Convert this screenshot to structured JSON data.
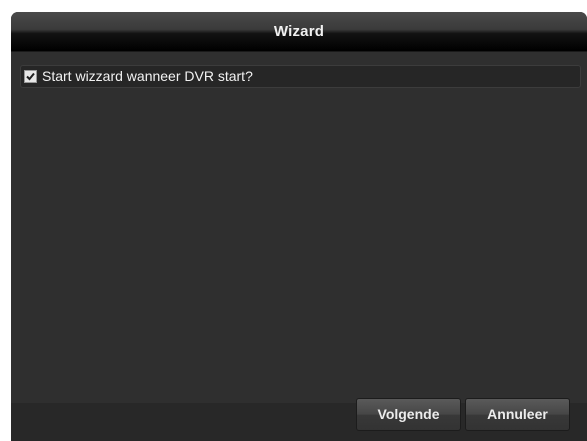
{
  "dialog": {
    "title": "Wizard",
    "option": {
      "label": "Start wizzard wanneer DVR start?",
      "checked": true
    },
    "buttons": {
      "next_label": "Volgende",
      "cancel_label": "Annuleer"
    }
  },
  "colors": {
    "background": "#2f2f2f",
    "title_text": "#f0f0f0",
    "text": "#f2f2f2",
    "checkbox_fill": "#e8e8e8",
    "checkmark": "#202020"
  },
  "icons": {
    "checkbox": "checkbox-checked-icon"
  }
}
